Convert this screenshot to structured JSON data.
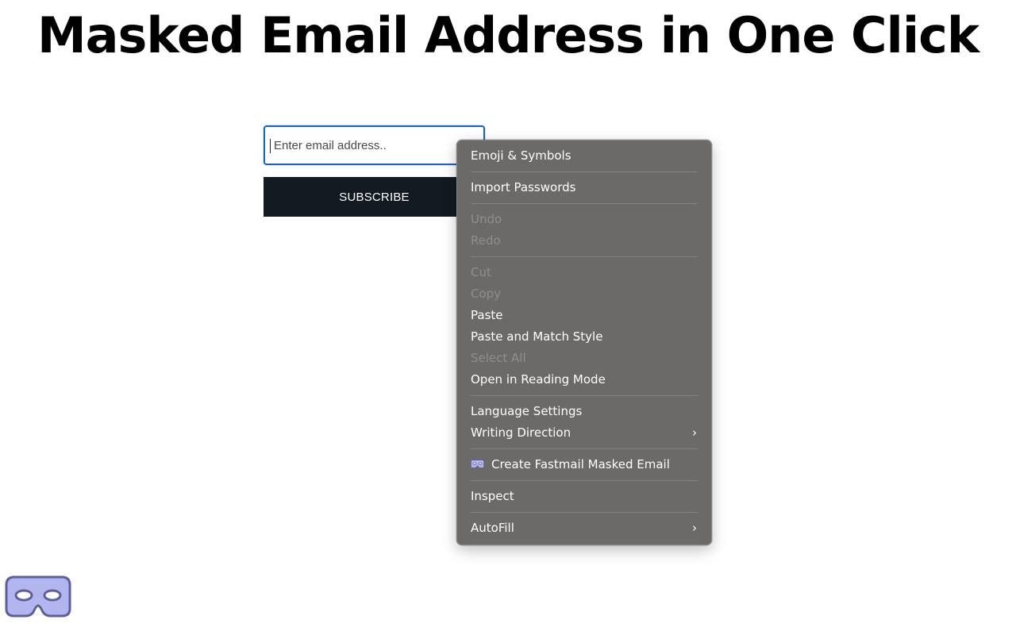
{
  "headline": "Masked Email Address in One Click",
  "form": {
    "email_placeholder": "Enter email address..",
    "subscribe_label": "SUBSCRIBE"
  },
  "context_menu": {
    "groups": [
      [
        {
          "label": "Emoji & Symbols",
          "enabled": true
        }
      ],
      [
        {
          "label": "Import Passwords",
          "enabled": true
        }
      ],
      [
        {
          "label": "Undo",
          "enabled": false
        },
        {
          "label": "Redo",
          "enabled": false
        }
      ],
      [
        {
          "label": "Cut",
          "enabled": false
        },
        {
          "label": "Copy",
          "enabled": false
        },
        {
          "label": "Paste",
          "enabled": true
        },
        {
          "label": "Paste and Match Style",
          "enabled": true
        },
        {
          "label": "Select All",
          "enabled": false
        },
        {
          "label": "Open in Reading Mode",
          "enabled": true
        }
      ],
      [
        {
          "label": "Language Settings",
          "enabled": true
        },
        {
          "label": "Writing Direction",
          "enabled": true,
          "submenu": true
        }
      ],
      [
        {
          "label": "Create Fastmail Masked Email",
          "enabled": true,
          "icon": "fastmail-mask-icon"
        }
      ],
      [
        {
          "label": "Inspect",
          "enabled": true
        }
      ],
      [
        {
          "label": "AutoFill",
          "enabled": true,
          "submenu": true
        }
      ]
    ],
    "submenu_arrow": "›"
  },
  "colors": {
    "menu_background": "#6b6a69",
    "input_focus_border": "#1a63c7",
    "button_background": "#131a22",
    "mask_fill": "#b3b5ef",
    "mask_stroke": "#5d5f9c"
  },
  "icons": {
    "corner_logo": "fastmail-mask-icon"
  }
}
